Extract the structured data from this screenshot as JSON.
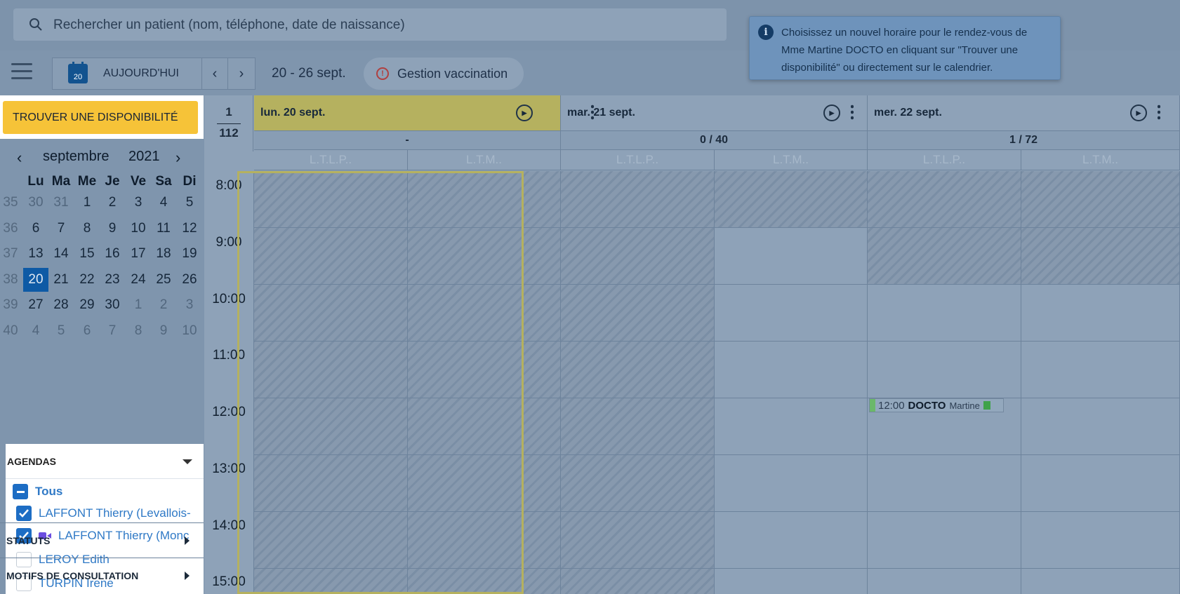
{
  "search": {
    "placeholder": "Rechercher un patient (nom, téléphone, date de naissance)"
  },
  "toolbar": {
    "today_label": "AUJOURD'HUI",
    "today_day": "20",
    "prev": "‹",
    "next": "›",
    "date_range": "20 - 26 sept.",
    "vaccination": "Gestion vaccination"
  },
  "tooltip": {
    "text": "Choisissez un nouvel horaire pour le rendez-vous de Mme Martine DOCTO en cliquant sur \"Trouver une disponibilité\" ou directement sur le calendrier."
  },
  "sidebar": {
    "find_button": "TROUVER UNE DISPONIBILITÉ",
    "month": "septembre",
    "year": "2021",
    "weekday_headers": [
      "Lu",
      "Ma",
      "Me",
      "Je",
      "Ve",
      "Sa",
      "Di"
    ],
    "weeks": [
      {
        "num": "35",
        "days": [
          "30",
          "31",
          "1",
          "2",
          "3",
          "4",
          "5"
        ]
      },
      {
        "num": "36",
        "days": [
          "6",
          "7",
          "8",
          "9",
          "10",
          "11",
          "12"
        ]
      },
      {
        "num": "37",
        "days": [
          "13",
          "14",
          "15",
          "16",
          "17",
          "18",
          "19"
        ]
      },
      {
        "num": "38",
        "days": [
          "20",
          "21",
          "22",
          "23",
          "24",
          "25",
          "26"
        ]
      },
      {
        "num": "39",
        "days": [
          "27",
          "28",
          "29",
          "30",
          "1",
          "2",
          "3"
        ]
      },
      {
        "num": "40",
        "days": [
          "4",
          "5",
          "6",
          "7",
          "8",
          "9",
          "10"
        ]
      }
    ],
    "agendas_title": "AGENDAS",
    "agendas": [
      {
        "label": "Tous",
        "state": "partial"
      },
      {
        "label": "LAFFONT Thierry (Levallois-",
        "state": "checked"
      },
      {
        "label": "LAFFONT Thierry (Monc⁠",
        "state": "checked",
        "video": true
      },
      {
        "label": "LEROY Edith",
        "state": "unchecked"
      },
      {
        "label": "TURPIN Irene",
        "state": "unchecked"
      }
    ],
    "statuts": "STATUTS",
    "motifs": "MOTIFS DE CONSULTATION"
  },
  "calendar": {
    "week_count": "1",
    "total": "112",
    "days": [
      {
        "label": "lun. 20 sept.",
        "count": "-",
        "today": true
      },
      {
        "label": "mar. 21 sept.",
        "count": "0 / 40"
      },
      {
        "label": "mer. 22 sept.",
        "count": "1 / 72"
      }
    ],
    "sub_labels": [
      "L.T.L.P..",
      "L.T.M.."
    ],
    "hours": [
      "8:00",
      "9:00",
      "10:00",
      "11:00",
      "12:00",
      "13:00",
      "14:00",
      "15:00"
    ],
    "appointment": {
      "time": "12:00",
      "name": "DOCTO",
      "first": "Martine"
    }
  },
  "colors": {
    "accent": "#f6c338",
    "selected": "#0e5aa5",
    "today_column": "#b5b15f",
    "link": "#2f79c6"
  }
}
